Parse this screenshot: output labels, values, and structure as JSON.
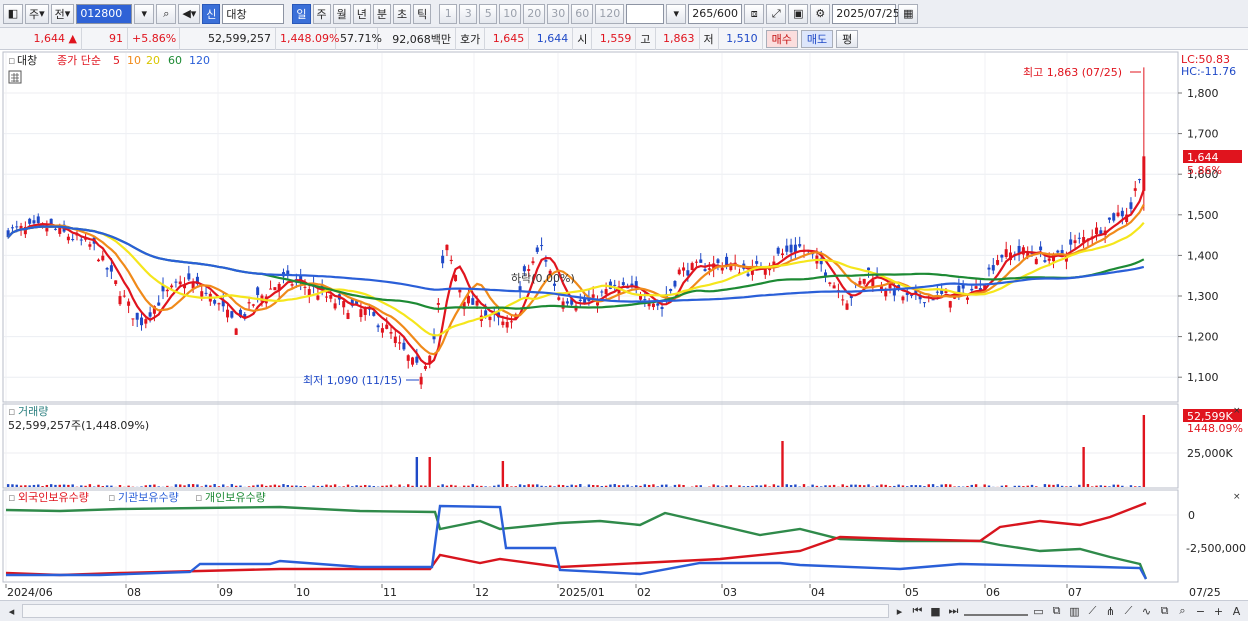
{
  "toolbar": {
    "market": "주",
    "prev": "전",
    "code": "012800",
    "new_badge": "신",
    "stock_name": "대창",
    "periods": [
      "일",
      "주",
      "월",
      "년",
      "분",
      "초",
      "틱"
    ],
    "intervals": [
      "1",
      "3",
      "5",
      "10",
      "20",
      "30",
      "60",
      "120"
    ],
    "count": "265",
    "count_total": "/600",
    "date": "2025/07/25"
  },
  "quote": {
    "price": "1,644",
    "change": "91",
    "change_pct": "+5.86%",
    "volume": "52,599,257",
    "volume_pct": "1,448.09%",
    "turnover": "57.71%",
    "amount": "92,068백만",
    "bid_label": "호가",
    "bid": "1,645",
    "ask": "1,644",
    "open_label": "시",
    "open": "1,559",
    "high_label": "고",
    "high": "1,863",
    "low_label": "저",
    "low": "1,510",
    "buy": "매수",
    "sell": "매도",
    "avg": "평"
  },
  "price_panel": {
    "legend_name": "대창",
    "legend_ma": "종가 단순",
    "ma_periods": [
      "5",
      "10",
      "20",
      "60",
      "120"
    ],
    "lc": "LC:50.83",
    "hc": "HC:-11.76",
    "ticks": [
      "1,800",
      "1,700",
      "1,600",
      "1,500",
      "1,400",
      "1,300",
      "1,200",
      "1,100"
    ],
    "cur_price": "1,644",
    "cur_pct": "5.86%",
    "high_note": "최고 1,863 (07/25)",
    "low_note": "최저 1,090 (11/15)",
    "mid_note": "하락(0.00%)"
  },
  "volume_panel": {
    "title": "거래량",
    "value": "52,599,257주(1,448.09%)",
    "tick": "25,000K",
    "badge": "52,599K",
    "badge_pct": "1448.09%"
  },
  "holdings_panel": {
    "legend": [
      "외국인보유수량",
      "기관보유수량",
      "개인보유수량"
    ],
    "ticks": [
      "0",
      "-2,500,000"
    ]
  },
  "x_axis": [
    "2024/06",
    "08",
    "09",
    "10",
    "11",
    "12",
    "2025/01",
    "02",
    "03",
    "04",
    "05",
    "06",
    "07",
    "07/25"
  ],
  "colors": {
    "ma5": "#e0141e",
    "ma10": "#f08a1a",
    "ma20": "#f5e61c",
    "ma60": "#1d8a34",
    "ma120": "#2a5fd8",
    "up": "#e0141e",
    "down": "#1f49c7"
  }
}
